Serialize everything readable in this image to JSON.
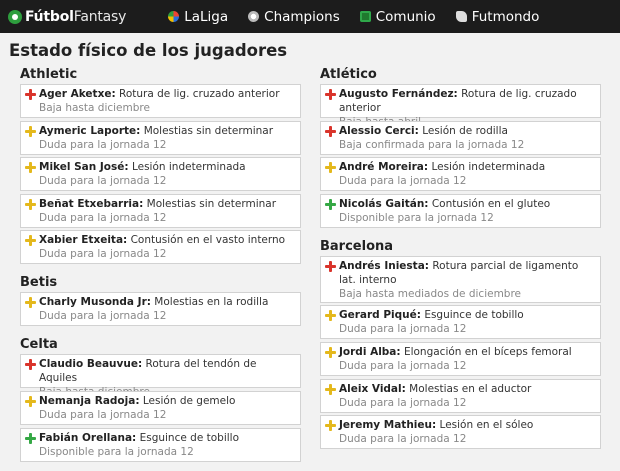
{
  "colors": {
    "red": "#d9342b",
    "yellow": "#e4b81c",
    "green": "#35a845",
    "nav_bg": "#1c1c1c"
  },
  "logo": {
    "bold": "Fútbol",
    "light": "Fantasy"
  },
  "nav": [
    {
      "label": "LaLiga",
      "icon": "laliga-icon"
    },
    {
      "label": "Champions",
      "icon": "champions-ball-icon"
    },
    {
      "label": "Comunio",
      "icon": "comunio-icon"
    },
    {
      "label": "Futmondo",
      "icon": "futmondo-icon"
    }
  ],
  "page_title": "Estado físico de los jugadores",
  "left_teams": [
    {
      "name": "Athletic",
      "players": [
        {
          "name": "Ager Aketxe:",
          "injury": "Rotura de lig. cruzado anterior",
          "status": "Baja hasta diciembre",
          "level": "red"
        },
        {
          "name": "Aymeric Laporte:",
          "injury": "Molestias sin determinar",
          "status": "Duda para la jornada 12",
          "level": "yellow"
        },
        {
          "name": "Mikel San José:",
          "injury": "Lesión indeterminada",
          "status": "Duda para la jornada 12",
          "level": "yellow"
        },
        {
          "name": "Beñat Etxebarria:",
          "injury": "Molestias sin determinar",
          "status": "Duda para la jornada 12",
          "level": "yellow"
        },
        {
          "name": "Xabier Etxeita:",
          "injury": "Contusión en el vasto interno",
          "status": "Duda para la jornada 12",
          "level": "yellow"
        }
      ]
    },
    {
      "name": "Betis",
      "players": [
        {
          "name": "Charly Musonda Jr:",
          "injury": "Molestias en la rodilla",
          "status": "Duda para la jornada 12",
          "level": "yellow"
        }
      ]
    },
    {
      "name": "Celta",
      "players": [
        {
          "name": "Claudio Beauvue:",
          "injury": "Rotura del tendón de Aquiles",
          "status": "Baja hasta diciembre",
          "level": "red"
        },
        {
          "name": "Nemanja Radoja:",
          "injury": "Lesión de gemelo",
          "status": "Duda para la jornada 12",
          "level": "yellow"
        },
        {
          "name": "Fabián Orellana:",
          "injury": "Esguince de tobillo",
          "status": "Disponible para la jornada 12",
          "level": "green"
        }
      ]
    }
  ],
  "right_teams": [
    {
      "name": "Atlético",
      "players": [
        {
          "name": "Augusto Fernández:",
          "injury": "Rotura de lig. cruzado anterior",
          "status": "Baja hasta abril",
          "level": "red"
        },
        {
          "name": "Alessio Cerci:",
          "injury": "Lesión de rodilla",
          "status": "Baja confirmada para la jornada 12",
          "level": "red"
        },
        {
          "name": "André Moreira:",
          "injury": "Lesión indeterminada",
          "status": "Duda para la jornada 12",
          "level": "yellow"
        },
        {
          "name": "Nicolás Gaitán:",
          "injury": "Contusión en el gluteo",
          "status": "Disponible para la jornada 12",
          "level": "green"
        }
      ]
    },
    {
      "name": "Barcelona",
      "players": [
        {
          "name": "Andrés Iniesta:",
          "injury": "Rotura parcial de ligamento lat. interno",
          "status": "Baja hasta mediados de diciembre",
          "level": "red",
          "tall": true
        },
        {
          "name": "Gerard Piqué:",
          "injury": "Esguince de tobillo",
          "status": "Duda para la jornada 12",
          "level": "yellow"
        },
        {
          "name": "Jordi Alba:",
          "injury": "Elongación en el bíceps femoral",
          "status": "Duda para la jornada 12",
          "level": "yellow"
        },
        {
          "name": "Aleix Vidal:",
          "injury": "Molestias en el aductor",
          "status": "Duda para la jornada 12",
          "level": "yellow"
        },
        {
          "name": "Jeremy Mathieu:",
          "injury": "Lesión en el sóleo",
          "status": "Duda para la jornada 12",
          "level": "yellow"
        }
      ]
    }
  ]
}
